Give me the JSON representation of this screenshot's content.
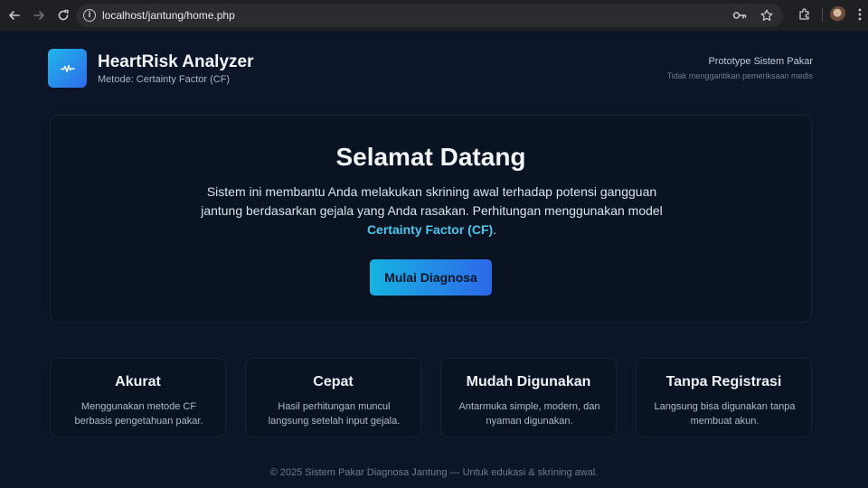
{
  "browser": {
    "url": "localhost/jantung/home.php",
    "icons": {
      "back": "arrow-left-icon",
      "forward": "arrow-right-icon",
      "reload": "reload-icon",
      "site_info": "info-icon",
      "password": "key-icon",
      "bookmark": "star-icon",
      "extensions": "puzzle-icon",
      "profile": "avatar",
      "menu": "kebab-menu-icon"
    }
  },
  "header": {
    "app_title": "HeartRisk Analyzer",
    "app_subtitle": "Metode: Certainty Factor (CF)",
    "proto_title": "Prototype Sistem Pakar",
    "proto_subtitle": "Tidak menggantikan pemeriksaan medis"
  },
  "hero": {
    "title": "Selamat Datang",
    "text_before": "Sistem ini membantu Anda melakukan skrining awal terhadap potensi gangguan jantung berdasarkan gejala yang Anda rasakan. Perhitungan menggunakan model",
    "highlight": "Certainty Factor (CF)",
    "text_after": ".",
    "cta_label": "Mulai Diagnosa"
  },
  "features": [
    {
      "title": "Akurat",
      "desc": "Menggunakan metode CF berbasis pengetahuan pakar."
    },
    {
      "title": "Cepat",
      "desc": "Hasil perhitungan muncul langsung setelah input gejala."
    },
    {
      "title": "Mudah Digunakan",
      "desc": "Antarmuka simple, modern, dan nyaman digunakan."
    },
    {
      "title": "Tanpa Registrasi",
      "desc": "Langsung bisa digunakan tanpa membuat akun."
    }
  ],
  "footer": {
    "text": "© 2025 Sistem Pakar Diagnosa Jantung — Untuk edukasi & skrining awal."
  },
  "colors": {
    "background": "#0c1628",
    "accent_start": "#16b3e0",
    "accent_end": "#2d68ea",
    "highlight": "#4ec6ec"
  }
}
